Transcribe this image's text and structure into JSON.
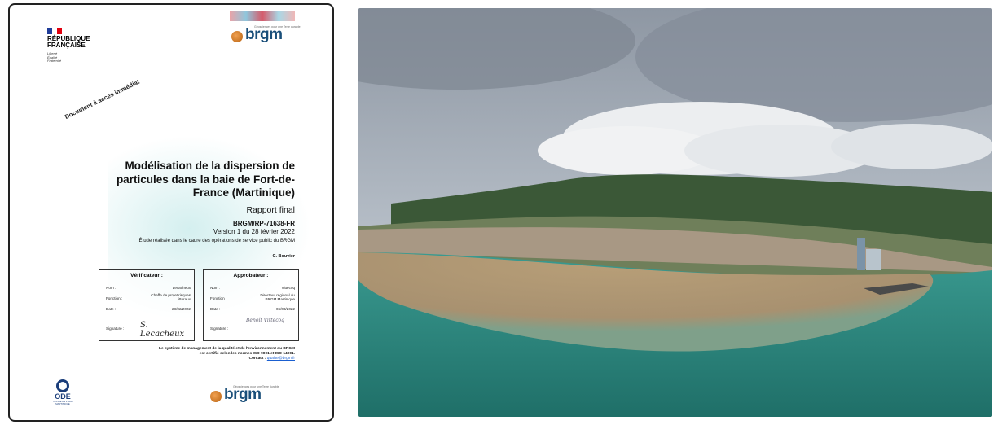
{
  "cover": {
    "republic": {
      "line1": "RÉPUBLIQUE",
      "line2": "FRANÇAISE",
      "motto1": "Liberté",
      "motto2": "Égalité",
      "motto3": "Fraternité"
    },
    "brgm_logo": {
      "word": "brgm",
      "tagline": "Géosciences pour une Terre durable"
    },
    "stamp": "Document à accès immédiat",
    "title": "Modélisation de la dispersion de particules dans la baie de Fort-de-France (Martinique)",
    "subtitle": "Rapport final",
    "reference": "BRGM/RP-71638-FR",
    "version": "Version 1 du 28 février 2022",
    "study_note": "Étude réalisée dans le cadre des opérations de service public du BRGM",
    "author": "C. Bouvier",
    "verifier": {
      "heading": "Vérificateur :",
      "name_label": "Nom :",
      "name": "Lecacheux",
      "function_label": "Fonction :",
      "function": "Cheffe de projet risques littoraux",
      "date_label": "Date :",
      "date": "28/02/2022",
      "signature_label": "Signature :",
      "signature": "S. Lecacheux"
    },
    "approver": {
      "heading": "Approbateur :",
      "name_label": "Nom :",
      "name": "Vittecoq",
      "function_label": "Fonction :",
      "function": "Directeur régional du BRGM Martinique",
      "date_label": "Date :",
      "date": "06/03/2022",
      "signature_label": "Signature :",
      "signature": "Benoît Vittecoq"
    },
    "quality": {
      "line1": "Le système de management de la qualité et de l'environnement du BRGM",
      "line2": "est certifié selon les normes ISO 9001 et ISO 14001.",
      "contact_label": "Contact :",
      "contact_email": "qualite@brgm.fr"
    },
    "ode_logo": {
      "word": "ODE",
      "small1": "OFFICE DE L'EAU",
      "small2": "MARTINIQUE"
    }
  },
  "photo": {
    "description_icon": "aerial-bay-photo-icon",
    "colors": {
      "sky": "#aeb6c0",
      "cloud": "#e8ebee",
      "hills": "#3e5a3a",
      "city": "#9b8f7f",
      "sediment": "#b39a73",
      "sea": "#2f8c83"
    }
  }
}
